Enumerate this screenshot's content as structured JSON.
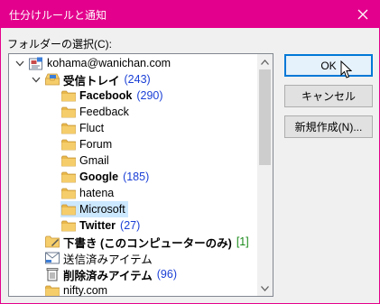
{
  "window": {
    "title": "仕分けルールと通知",
    "accent_color": "#e3008c"
  },
  "folder_select_label": "フォルダーの選択(C):",
  "tree": [
    {
      "label": "kohama@wanichan.com",
      "count": "",
      "bold": false,
      "icon": "mailbox-icon",
      "expander": "chevron-down-icon",
      "level": 0,
      "selected": false
    },
    {
      "label": "受信トレイ",
      "count": "(243)",
      "bold": true,
      "icon": "inbox-icon",
      "expander": "chevron-down-icon",
      "level": 1,
      "selected": false
    },
    {
      "label": "Facebook",
      "count": "(290)",
      "bold": true,
      "icon": "folder-icon",
      "level": 2,
      "selected": false
    },
    {
      "label": "Feedback",
      "count": "",
      "bold": false,
      "icon": "folder-icon",
      "level": 2,
      "selected": false
    },
    {
      "label": "Fluct",
      "count": "",
      "bold": false,
      "icon": "folder-icon",
      "level": 2,
      "selected": false
    },
    {
      "label": "Forum",
      "count": "",
      "bold": false,
      "icon": "folder-icon",
      "level": 2,
      "selected": false
    },
    {
      "label": "Gmail",
      "count": "",
      "bold": false,
      "icon": "folder-icon",
      "level": 2,
      "selected": false
    },
    {
      "label": "Google",
      "count": "(185)",
      "bold": true,
      "icon": "folder-icon",
      "level": 2,
      "selected": false
    },
    {
      "label": "hatena",
      "count": "",
      "bold": false,
      "icon": "folder-icon",
      "level": 2,
      "selected": false
    },
    {
      "label": "Microsoft",
      "count": "",
      "bold": false,
      "icon": "folder-icon",
      "level": 2,
      "selected": true
    },
    {
      "label": "Twitter",
      "count": "(27)",
      "bold": true,
      "icon": "folder-icon",
      "level": 2,
      "selected": false
    },
    {
      "label": "下書き (このコンピューターのみ)",
      "count": "[1]",
      "count_color": "green",
      "bold": true,
      "icon": "drafts-icon",
      "level": 1,
      "selected": false
    },
    {
      "label": "送信済みアイテム",
      "count": "",
      "bold": false,
      "icon": "sent-items-icon",
      "level": 1,
      "selected": false
    },
    {
      "label": "削除済みアイテム",
      "count": "(96)",
      "bold": true,
      "icon": "trash-icon",
      "level": 1,
      "selected": false
    },
    {
      "label": "nifty.com",
      "count": "",
      "bold": false,
      "icon": "folder-icon",
      "level": 1,
      "selected": false
    }
  ],
  "buttons": {
    "ok": "OK",
    "cancel": "キャンセル",
    "new": "新規作成(N)..."
  }
}
